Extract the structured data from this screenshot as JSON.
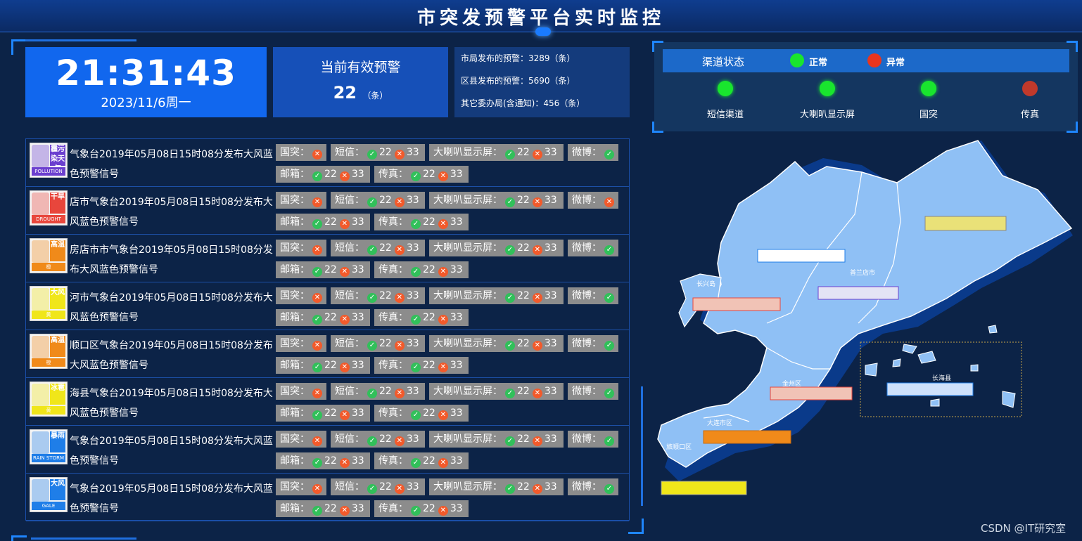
{
  "header": {
    "title": "市突发预警平台实时监控"
  },
  "clock": {
    "time": "21:31:43",
    "date": "2023/11/6周一"
  },
  "valid": {
    "label": "当前有效预警",
    "count": "22",
    "unit": "（条）"
  },
  "stats": [
    "市局发布的预警：3289（条）",
    "区县发布的预警：5690（条）",
    "其它委办局(含通知)：456（条）"
  ],
  "channel": {
    "title": "渠道状态",
    "legend_normal": "正常",
    "legend_error": "异常",
    "colors": {
      "normal": "#19e52e",
      "error": "#e8351e",
      "error_dim": "#c0392b"
    },
    "items": [
      {
        "name": "短信渠道",
        "status": "normal"
      },
      {
        "name": "大喇叭显示屏",
        "status": "normal"
      },
      {
        "name": "国突",
        "status": "normal"
      },
      {
        "name": "传真",
        "status": "error"
      }
    ]
  },
  "labels": {
    "guotu": "国突：",
    "sms": "短信：",
    "speaker": "大喇叭显示屏：",
    "weibo": "微博：",
    "mail": "邮箱：",
    "fax": "传真：",
    "ok_count": "22",
    "err_count": "33"
  },
  "warnings": [
    {
      "text": "气象台2019年05月08日15时08分发布大风蓝色预警信号",
      "icon": "pollution-icon",
      "badge": "霾污染天气",
      "foot": "POLLUTION",
      "color": "#6b3fcf",
      "weibo": "ok"
    },
    {
      "text": "店市气象台2019年05月08日15时08分发布大风蓝色预警信号",
      "icon": "drought-icon",
      "badge": "干旱",
      "foot": "DROUGHT",
      "color": "#e8463c",
      "weibo": "err"
    },
    {
      "text": "房店市市气象台2019年05月08日15时08分发布大风蓝色预警信号",
      "icon": "heat-icon",
      "badge": "高温",
      "foot": "橙",
      "color": "#f08a1a",
      "weibo": "ok"
    },
    {
      "text": "河市气象台2019年05月08日15时08分发布大风蓝色预警信号",
      "icon": "gale-icon",
      "badge": "大风",
      "foot": "黄",
      "color": "#f0e61a",
      "weibo": "ok"
    },
    {
      "text": "顺口区气象台2019年05月08日15时08分发布大风蓝色预警信号",
      "icon": "heat-icon",
      "badge": "高温",
      "foot": "橙",
      "color": "#f08a1a",
      "weibo": "ok"
    },
    {
      "text": "海县气象台2019年05月08日15时08分发布大风蓝色预警信号",
      "icon": "hail-icon",
      "badge": "冰雹",
      "foot": "黄",
      "color": "#f0e61a",
      "weibo": "ok"
    },
    {
      "text": "气象台2019年05月08日15时08分发布大风蓝色预警信号",
      "icon": "rainstorm-icon",
      "badge": "暴雨",
      "foot": "RAIN STORM",
      "color": "#1f7ee8",
      "weibo": "ok"
    },
    {
      "text": "气象台2019年05月08日15时08分发布大风蓝色预警信号",
      "icon": "gale-icon",
      "badge": "大风",
      "foot": "GALE",
      "color": "#1f7ee8",
      "weibo": "ok"
    }
  ],
  "map": {
    "regions": [
      "长兴岛",
      "普兰店市",
      "金州区",
      "大连市区",
      "旅顺口区",
      "长海县"
    ]
  },
  "watermark": "CSDN @IT研究室"
}
